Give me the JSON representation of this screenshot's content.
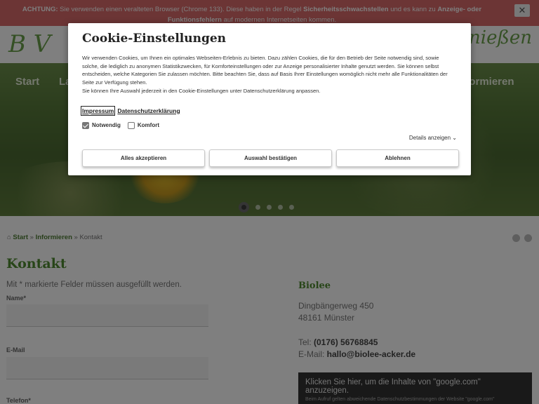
{
  "warning": {
    "prefix": "ACHTUNG:",
    "text1": " Sie verwenden einen veralteten Browser (Chrome 133). Diese haben in der Regel ",
    "bold1": "Sicherheitsschwachstellen",
    "text2": " und es kann zu ",
    "bold2": "Anzeige- oder Funktionsfehlern",
    "text3": " auf modernen Internetseiten kommen.",
    "close_label": "✕"
  },
  "header": {
    "logo_text": "B V",
    "tagline": "genießen"
  },
  "nav": {
    "items": [
      "Start",
      "La",
      "Informieren"
    ]
  },
  "breadcrumb": {
    "home": "Start",
    "sep1": " » ",
    "level2": "Informieren",
    "sep2": " » ",
    "current": "Kontakt"
  },
  "main": {
    "title": "Kontakt",
    "required_note": "Mit * markierte Felder müssen ausgefüllt werden.",
    "fields": [
      "Name*",
      "E-Mail",
      "Telefon*"
    ]
  },
  "sidebar": {
    "company": "Biolee",
    "street": "Dingbängerweg 450",
    "city": "48161 Münster",
    "tel_label": "Tel: ",
    "tel": "(0176) 56768845",
    "email_label": "E-Mail: ",
    "email": "hallo@biolee-acker.de",
    "google_title": "Klicken Sie hier, um die Inhalte von \"google.com\" anzuzeigen.",
    "google_note": "Beim Aufruf gelten abweichende Datenschutzbestimmungen der Website \"google.com\""
  },
  "cookie": {
    "title": "Cookie-Einstellungen",
    "text1": "Wir verwenden Cookies, um Ihnen ein optimales Webseiten-Erlebnis zu bieten. Dazu zählen Cookies, die für den Betrieb der Seite notwendig sind, sowie solche, die lediglich zu anonymen Statistikzwecken, für Komforteinstellungen oder zur Anzeige personalisierter Inhalte genutzt werden. Sie können selbst entscheiden, welche Kategorien Sie zulassen möchten. Bitte beachten Sie, dass auf Basis Ihrer Einstellungen womöglich nicht mehr alle Funktionalitäten der Seite zur Verfügung stehen.",
    "text2": "Sie können Ihre Auswahl jederzeit in den Cookie-Einstellungen unter Datenschutzerklärung anpassen.",
    "link_impressum": "Impressum",
    "link_datenschutz": "Datenschutzerklärung",
    "check_notwendig": "Notwendig",
    "check_komfort": "Komfort",
    "details": "Details anzeigen",
    "btn_accept_all": "Alles akzeptieren",
    "btn_confirm": "Auswahl bestätigen",
    "btn_decline": "Ablehnen"
  },
  "colors": {
    "accent_green": "#4f8a30",
    "warning_red": "#d96a6a"
  }
}
